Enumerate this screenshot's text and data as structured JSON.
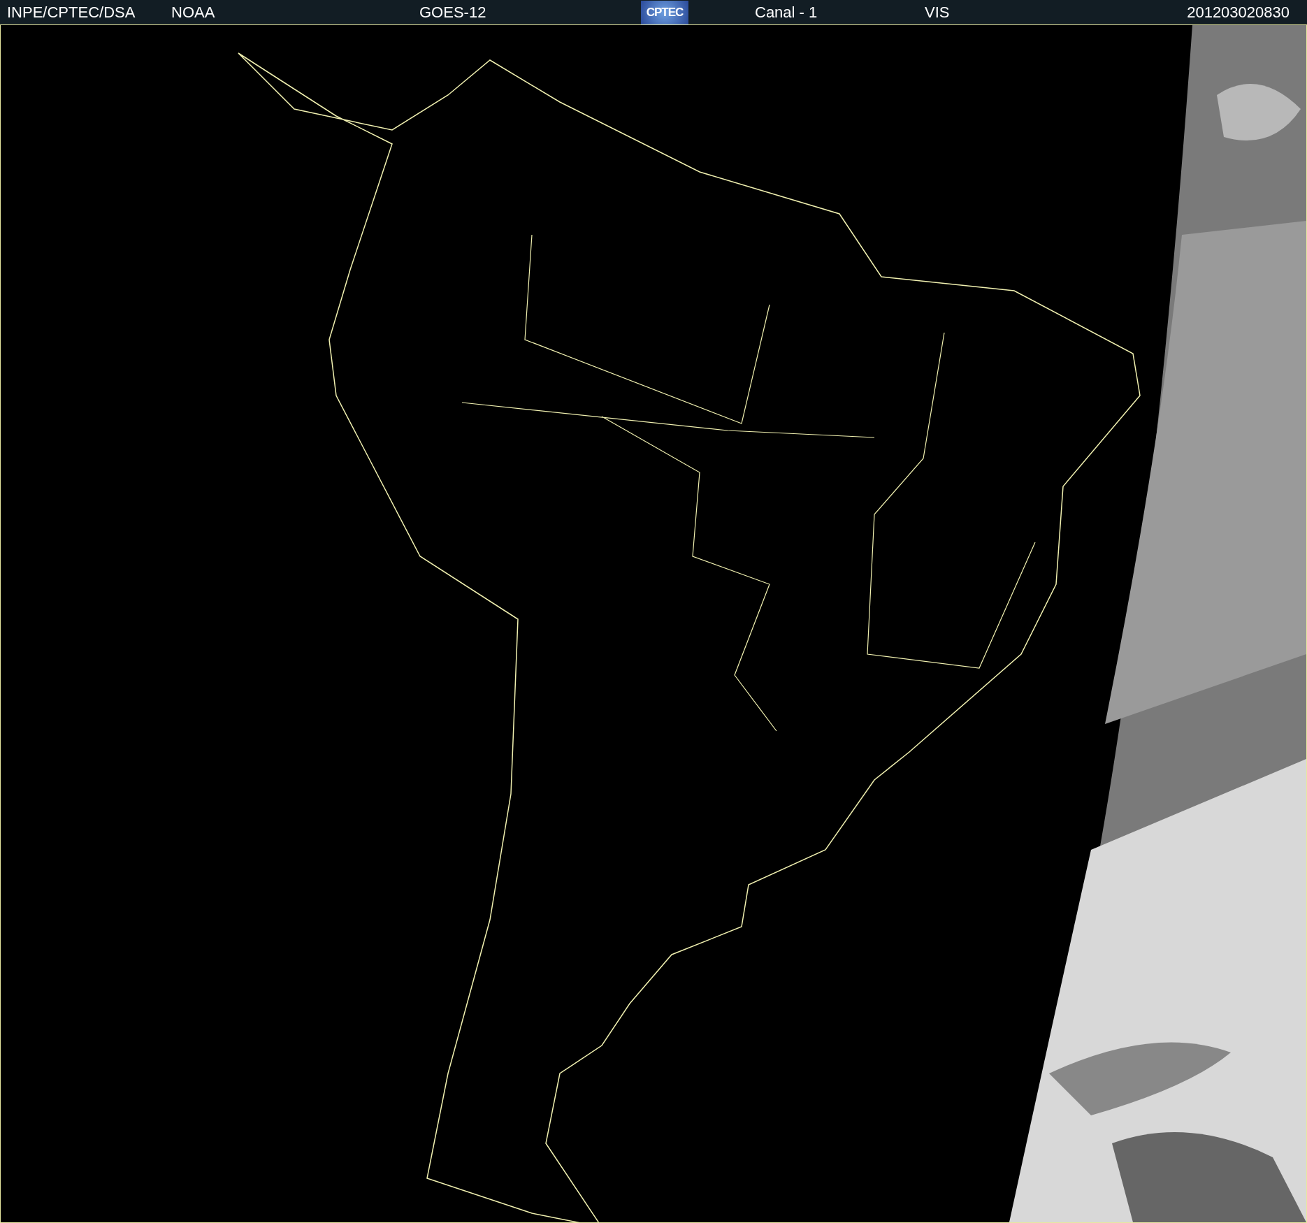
{
  "header": {
    "items": [
      {
        "kind": "text",
        "text": "INPE/CPTEC/DSA"
      },
      {
        "kind": "text",
        "text": "NOAA"
      },
      {
        "kind": "text",
        "text": "GOES-12"
      },
      {
        "kind": "logo",
        "text": "CPTEC"
      },
      {
        "kind": "text",
        "text": "Canal - 1"
      },
      {
        "kind": "text",
        "text": "VIS"
      },
      {
        "kind": "text",
        "text": "201203020830"
      }
    ]
  }
}
